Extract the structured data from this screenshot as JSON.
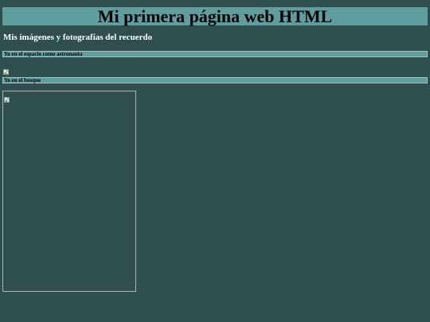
{
  "page": {
    "title": "Mi primera página web HTML",
    "subtitle": "Mis imágenes y fotografías del recuerdo"
  },
  "gallery": [
    {
      "caption": "Yo en el espacio como astronauta",
      "image_icon": "broken-image-icon"
    },
    {
      "caption": "Yo en el bosque",
      "image_icon": "broken-image-icon"
    }
  ],
  "colors": {
    "background": "#2f4f4f",
    "bar": "#5f9ea0",
    "heading_text": "#000000",
    "subtitle_text": "#ffffff"
  }
}
